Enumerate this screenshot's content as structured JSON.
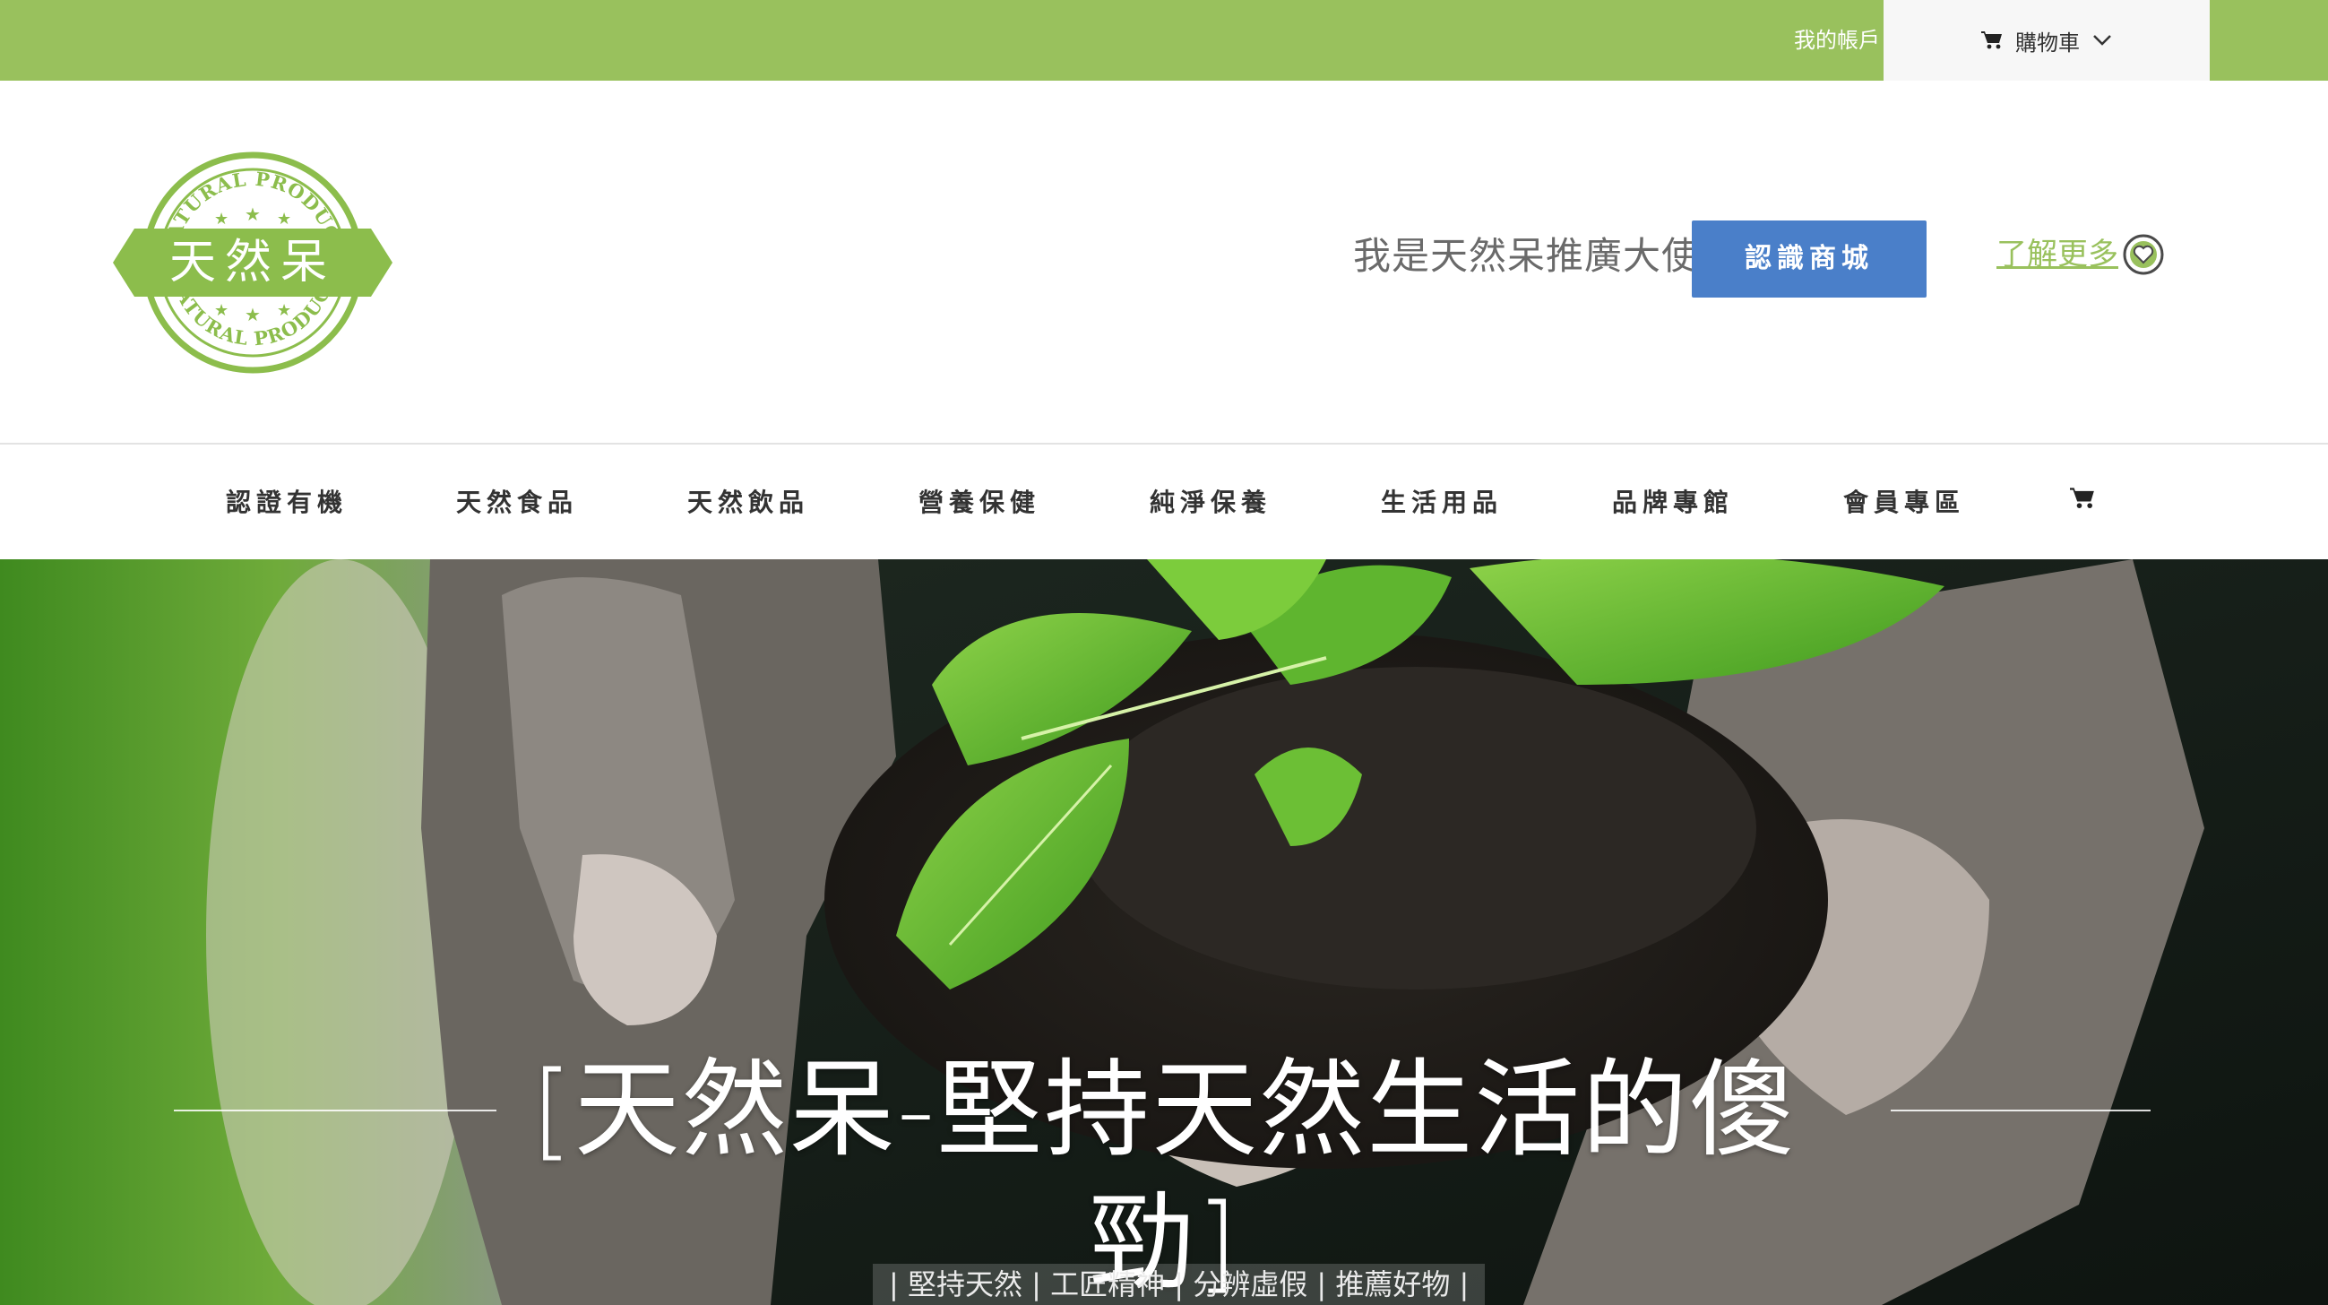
{
  "topbar": {
    "account_label": "我的帳戶",
    "cart_label": "購物車",
    "cart_icon": "cart-icon",
    "dropdown_icon": "chevron-down-icon",
    "bg_color": "#99c15d"
  },
  "header": {
    "logo": {
      "arc_top": "NATURAL PRODUCT",
      "center": "天然呆",
      "arc_bottom": "NATURAL PRODUCT",
      "color": "#8cbd4c"
    },
    "ambassador_text": "我是天然呆推廣大使",
    "shop_button_label": "認識商城",
    "shop_button_color": "#4a7fc9",
    "learn_more_label": "了解更多",
    "learn_more_icon": "heart-badge-icon"
  },
  "nav": {
    "items": [
      {
        "label": "認證有機"
      },
      {
        "label": "天然食品"
      },
      {
        "label": "天然飲品"
      },
      {
        "label": "營養保健"
      },
      {
        "label": "純淨保養"
      },
      {
        "label": "生活用品"
      },
      {
        "label": "品牌專館"
      },
      {
        "label": "會員專區"
      }
    ],
    "cart_icon": "cart-icon"
  },
  "hero": {
    "title": "[天然呆-堅持天然生活的傻勁]",
    "tagline": "| 堅持天然 | 工匠精神 | 分辨虛假 | 推薦好物 |"
  }
}
